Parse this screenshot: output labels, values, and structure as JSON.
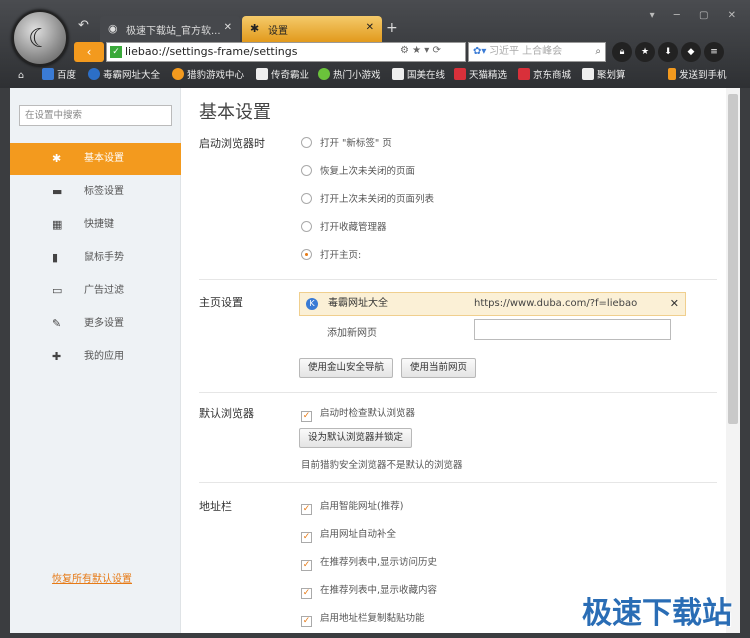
{
  "browser": {
    "tabs": [
      {
        "label": "极速下载站_官方软..."
      },
      {
        "label": "设置"
      }
    ],
    "new_tab": "+",
    "url": "liebao://settings-frame/settings",
    "search_placeholder": "习近平 上合峰会",
    "bookmarks": [
      {
        "label": "百度"
      },
      {
        "label": "毒霸网址大全"
      },
      {
        "label": "猎豹游戏中心"
      },
      {
        "label": "传奇霸业"
      },
      {
        "label": "热门小游戏"
      },
      {
        "label": "国美在线"
      },
      {
        "label": "天猫精选"
      },
      {
        "label": "京东商城"
      },
      {
        "label": "聚划算"
      },
      {
        "label": "发送到手机"
      }
    ],
    "icons": {
      "logo": "cheetah-logo-icon",
      "back": "back-icon",
      "security": "secure-icon"
    }
  },
  "sidebar": {
    "search_placeholder": "在设置中搜索",
    "items": [
      {
        "label": "基本设置",
        "icon": "gear-icon",
        "active": true
      },
      {
        "label": "标签设置",
        "icon": "laptop-icon"
      },
      {
        "label": "快捷键",
        "icon": "keyboard-icon"
      },
      {
        "label": "鼠标手势",
        "icon": "mouse-icon"
      },
      {
        "label": "广告过滤",
        "icon": "window-icon"
      },
      {
        "label": "更多设置",
        "icon": "wrench-icon"
      },
      {
        "label": "我的应用",
        "icon": "puzzle-icon"
      }
    ],
    "restore_link": "恢复所有默认设置"
  },
  "main": {
    "title": "基本设置",
    "startup": {
      "label": "启动浏览器时",
      "options": [
        {
          "label": "打开 \"新标签\" 页",
          "checked": false
        },
        {
          "label": "恢复上次未关闭的页面",
          "checked": false
        },
        {
          "label": "打开上次未关闭的页面列表",
          "checked": false
        },
        {
          "label": "打开收藏管理器",
          "checked": false
        },
        {
          "label": "打开主页:",
          "checked": true
        }
      ]
    },
    "homepage": {
      "label": "主页设置",
      "entry_name": "毒霸网址大全",
      "entry_url": "https://www.duba.com/?f=liebao",
      "close": "✕",
      "add_label": "添加新网页",
      "btn_safe_nav": "使用金山安全导航",
      "btn_current": "使用当前网页"
    },
    "default_browser": {
      "label": "默认浏览器",
      "check_on_start": "启动时检查默认浏览器",
      "btn_set_default": "设为默认浏览器并锁定",
      "status": "目前猎豹安全浏览器不是默认的浏览器"
    },
    "address_bar": {
      "label": "地址栏",
      "options": [
        {
          "label": "启用智能网址(推荐)",
          "checked": true
        },
        {
          "label": "启用网址自动补全",
          "checked": true
        },
        {
          "label": "在推荐列表中,显示访问历史",
          "checked": true
        },
        {
          "label": "在推荐列表中,显示收藏内容",
          "checked": true
        },
        {
          "label": "启用地址栏复制黏贴功能",
          "checked": true
        }
      ]
    }
  },
  "watermark": "极速下载站"
}
